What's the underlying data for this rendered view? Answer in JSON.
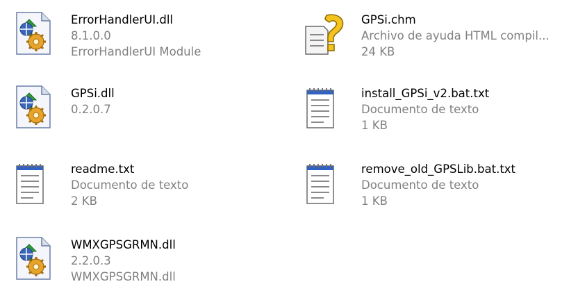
{
  "files": [
    {
      "name": "ErrorHandlerUI.dll",
      "line2": "8.1.0.0",
      "line3": "ErrorHandlerUI Module",
      "icon": "dll-gear-icon"
    },
    {
      "name": "GPSi.dll",
      "line2": "0.2.0.7",
      "line3": "",
      "icon": "dll-gear-icon"
    },
    {
      "name": "readme.txt",
      "line2": "Documento de texto",
      "line3": "2 KB",
      "icon": "text-document-icon"
    },
    {
      "name": "WMXGPSGRMN.dll",
      "line2": "2.2.0.3",
      "line3": "WMXGPSGRMN.dll",
      "icon": "dll-gear-icon"
    },
    {
      "name": "GPSi.chm",
      "line2": "Archivo de ayuda HTML compil...",
      "line3": "24 KB",
      "icon": "help-file-icon"
    },
    {
      "name": "install_GPSi_v2.bat.txt",
      "line2": "Documento de texto",
      "line3": "1 KB",
      "icon": "text-document-icon"
    },
    {
      "name": "remove_old_GPSLib.bat.txt",
      "line2": "Documento de texto",
      "line3": "1 KB",
      "icon": "text-document-icon"
    }
  ]
}
